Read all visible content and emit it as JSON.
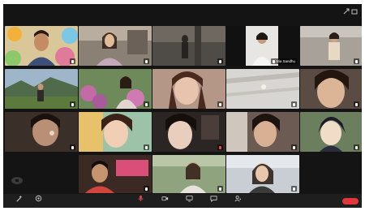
{
  "window": {
    "top_icons": [
      "minimize-icon",
      "fullscreen-icon"
    ]
  },
  "participants": [
    {
      "name": "",
      "muted": false,
      "scene": "portrait-man-cartoon"
    },
    {
      "name": "",
      "muted": false,
      "scene": "girl-room"
    },
    {
      "name": "",
      "muted": false,
      "scene": "person-dim-room"
    },
    {
      "name": "Nia Sandhu",
      "muted": false,
      "scene": "woman-doorway"
    },
    {
      "name": "",
      "muted": false,
      "scene": "girl-standing"
    },
    {
      "name": "",
      "muted": false,
      "scene": "mountain-outdoor"
    },
    {
      "name": "",
      "muted": false,
      "scene": "flowers"
    },
    {
      "name": "",
      "muted": false,
      "scene": "girl-closeup"
    },
    {
      "name": "",
      "muted": false,
      "scene": "ceiling-light"
    },
    {
      "name": "",
      "muted": false,
      "scene": "girl-closeup-2"
    },
    {
      "name": "",
      "muted": false,
      "scene": "person-face"
    },
    {
      "name": "",
      "muted": false,
      "scene": "girl-bright"
    },
    {
      "name": "",
      "muted": true,
      "scene": "girl-dark"
    },
    {
      "name": "",
      "muted": false,
      "scene": "girl-window"
    },
    {
      "name": "",
      "muted": false,
      "scene": "anime-character"
    },
    {
      "name": "",
      "muted": false,
      "scene": "kid-banner"
    },
    {
      "name": "",
      "muted": false,
      "scene": "person-outdoor"
    },
    {
      "name": "",
      "muted": false,
      "scene": "girl-window-2"
    }
  ],
  "toolbar": {
    "left": [
      {
        "icon": "wand-icon",
        "label": ""
      },
      {
        "icon": "settings-icon",
        "label": ""
      }
    ],
    "center": [
      {
        "icon": "microphone-icon",
        "label": ""
      },
      {
        "icon": "camera-icon",
        "label": ""
      },
      {
        "icon": "share-screen-icon",
        "label": ""
      },
      {
        "icon": "chat-icon",
        "label": ""
      },
      {
        "icon": "participants-icon",
        "label": ""
      }
    ],
    "leave_label": ""
  },
  "colors": {
    "background": "#141414",
    "toolbar": "#1e1e1e",
    "leave": "#e0373d",
    "muted_mic": "#e34b4b"
  }
}
